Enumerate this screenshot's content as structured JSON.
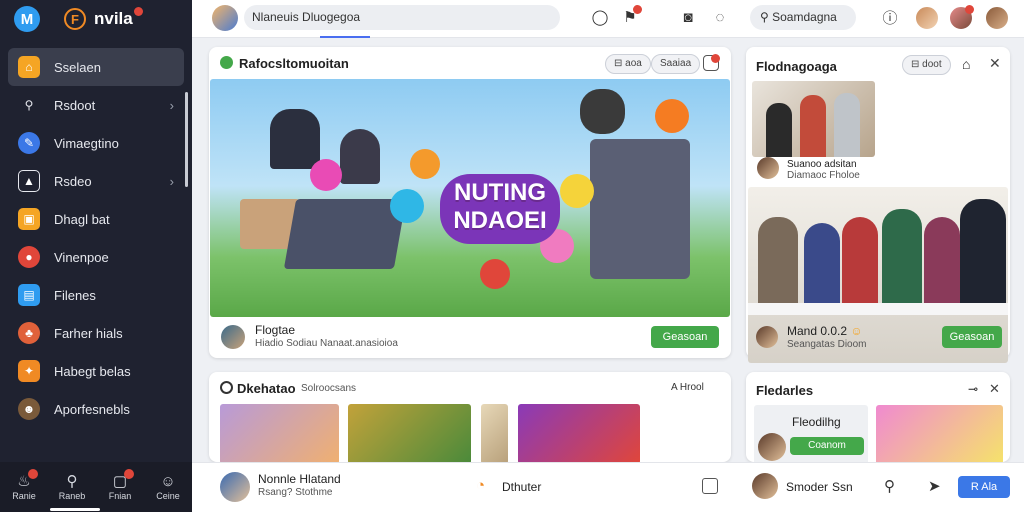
{
  "sidebar": {
    "brand": "nvila",
    "items": [
      {
        "label": "Sselaen",
        "icon": "home-icon",
        "color": "#f5a524"
      },
      {
        "label": "Rsdoot",
        "icon": "search-icon",
        "color": "#1f2230"
      },
      {
        "label": "Vimaegtino",
        "icon": "pen-icon",
        "color": "#3b78e7"
      },
      {
        "label": "Rsdeo",
        "icon": "image-icon",
        "color": "#1f2230"
      },
      {
        "label": "Dhagl bat",
        "icon": "chat-icon",
        "color": "#f5a524"
      },
      {
        "label": "Vinenpoe",
        "icon": "video-icon",
        "color": "#e0463a"
      },
      {
        "label": "Filenes",
        "icon": "file-icon",
        "color": "#2f9cf0"
      },
      {
        "label": "Farher hials",
        "icon": "people-icon",
        "color": "#e0613a"
      },
      {
        "label": "Habegt belas",
        "icon": "bell-icon",
        "color": "#f08a24"
      },
      {
        "label": "Aporfesnebls",
        "icon": "user-icon",
        "color": "#7a5a3a"
      }
    ],
    "bottom": [
      {
        "label": "Ranie",
        "icon": "alert-icon"
      },
      {
        "label": "Raneb",
        "icon": "search-icon"
      },
      {
        "label": "Fnian",
        "icon": "message-icon"
      },
      {
        "label": "Ceine",
        "icon": "user-icon"
      }
    ]
  },
  "topbar": {
    "search_text": "Nlaneuis Dluogegoa",
    "pill_text": "Soamdagna"
  },
  "main_card": {
    "title": "Rafocsltomuoitan",
    "btn1": "aoa",
    "btn2": "Saaiaa",
    "hero_text": "NUTING NDAOEI",
    "author": "Flogtae",
    "meta": "Hiadio Sodiau Nanaat.anasioioa",
    "action": "Geasoan"
  },
  "right_card": {
    "title": "Flodnagoaga",
    "btn": "doot",
    "person1": "Suanoo adsitan",
    "person1_sub": "Diamaoc Fholoe",
    "person2": "Mand 0.0.2",
    "person2_sub": "Seangatas Dioom",
    "action": "Geasoan"
  },
  "bottom_left": {
    "title": "Dkehatao",
    "sub": "Solroocsans",
    "right_label": "A Hrool"
  },
  "bottom_right": {
    "title": "Fledarles",
    "card_label": "Fleodilhg",
    "card_btn": "Coanom"
  },
  "bottom_bar": {
    "name": "Nonnle Hlatand",
    "sub": "Rsang? Stothme",
    "center": "Dthuter",
    "user": "Smoder",
    "user2": "Ssn",
    "button": "R Ala"
  }
}
